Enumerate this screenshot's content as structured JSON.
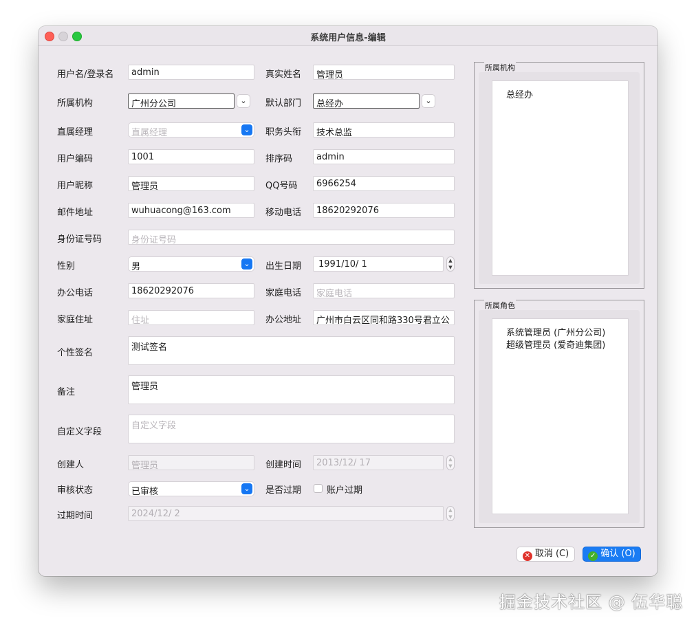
{
  "window": {
    "title": "系统用户信息-编辑"
  },
  "form": {
    "username": {
      "label": "用户名/登录名",
      "value": "admin"
    },
    "realname": {
      "label": "真实姓名",
      "value": "管理员"
    },
    "org": {
      "label": "所属机构",
      "value": "广州分公司"
    },
    "dept": {
      "label": "默认部门",
      "value": "总经办"
    },
    "manager": {
      "label": "直属经理",
      "placeholder": "直属经理"
    },
    "jobtitle": {
      "label": "职务头衔",
      "value": "技术总监"
    },
    "usercode": {
      "label": "用户编码",
      "value": "1001"
    },
    "sortcode": {
      "label": "排序码",
      "value": "admin"
    },
    "nickname": {
      "label": "用户昵称",
      "value": "管理员"
    },
    "qq": {
      "label": "QQ号码",
      "value": "6966254"
    },
    "email": {
      "label": "邮件地址",
      "value": "wuhuacong@163.com"
    },
    "mobile": {
      "label": "移动电话",
      "value": "18620292076"
    },
    "idcard": {
      "label": "身份证号码",
      "placeholder": "身份证号码"
    },
    "gender": {
      "label": "性别",
      "value": "男"
    },
    "birthday": {
      "label": "出生日期",
      "value": "1991/10/   1"
    },
    "officephone": {
      "label": "办公电话",
      "value": "18620292076"
    },
    "homephone": {
      "label": "家庭电话",
      "placeholder": "家庭电话"
    },
    "homeaddr": {
      "label": "家庭住址",
      "placeholder": "住址"
    },
    "officeaddr": {
      "label": "办公地址",
      "value": "广州市白云区同和路330号君立公"
    },
    "signature": {
      "label": "个性签名",
      "value": "测试签名"
    },
    "remark": {
      "label": "备注",
      "value": "管理员"
    },
    "custom": {
      "label": "自定义字段",
      "placeholder": "自定义字段"
    },
    "creator": {
      "label": "创建人",
      "value": "管理员"
    },
    "createtime": {
      "label": "创建时间",
      "value": "2013/12/ 17"
    },
    "audit": {
      "label": "审核状态",
      "value": "已审核"
    },
    "expired": {
      "label": "是否过期",
      "checkbox_label": "账户过期",
      "checked": false
    },
    "expiretime": {
      "label": "过期时间",
      "value": "2024/12/   2"
    }
  },
  "org_panel": {
    "title": "所属机构",
    "items": [
      "总经办"
    ]
  },
  "role_panel": {
    "title": "所属角色",
    "items": [
      "系统管理员 (广州分公司)",
      "超级管理员 (爱奇迪集团)"
    ]
  },
  "buttons": {
    "cancel": "取消 (C)",
    "ok": "确认 (O)"
  },
  "watermark": "掘金技术社区 @ 伍华聪"
}
